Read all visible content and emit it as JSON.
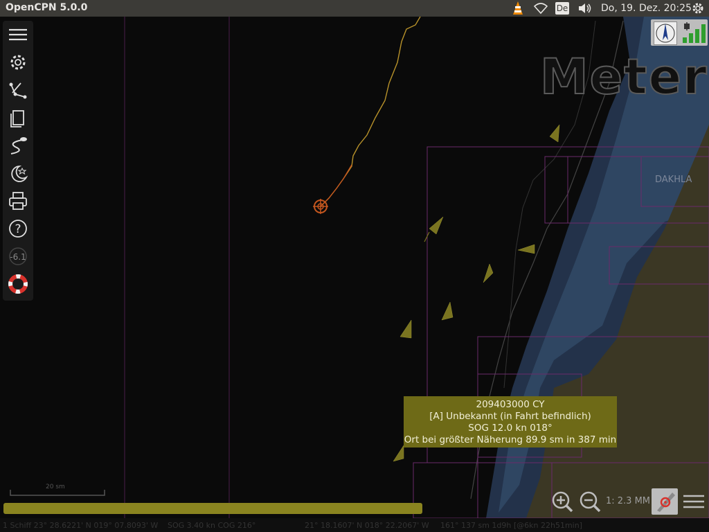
{
  "topbar": {
    "title": "OpenCPN 5.0.0",
    "keyboard_layout": "De",
    "clock": "Do, 19. Dez. 20:25",
    "tray_icons": [
      "vlc-icon",
      "wifi-icon",
      "keyboard-layout",
      "volume-icon",
      "settings-gear-icon"
    ]
  },
  "toolbar": {
    "items": [
      "menu-icon",
      "gear-icon",
      "route-icon",
      "document-icon",
      "track-icon",
      "moon-star-icon",
      "printer-icon",
      "help-icon",
      "compass-icon",
      "lifebuoy-icon"
    ],
    "compass_value": "-6.1"
  },
  "chart": {
    "watermark": "Meter",
    "place_label": "DAKHLA",
    "colors": {
      "water_deep": "#0a0a0a",
      "water_shallow": "#1f2c3e",
      "water_mid": "#2a3b52",
      "land": "#3d3824",
      "boundary": "#6b2a6b",
      "track": "#b8922a",
      "ais": "#7a7420"
    }
  },
  "tooltip": {
    "line1": "209403000 CY",
    "line2": "[A] Unbekannt (in Fahrt befindlich)",
    "line3": "SOG 12.0 kn 018°",
    "line4": "Ort bei größter Näherung 89.9 sm in 387 min"
  },
  "controls": {
    "scale": "1: 2.3 MM",
    "scale_bar_label": "20 sm"
  },
  "progress": {
    "fraction": 1.0
  },
  "statusbar": {
    "ship": "1 Schiff 23° 28.6221' N   019° 07.8093' W",
    "sog": "SOG 3.40 kn  COG 216°",
    "cursor": "21° 18.1607' N   018° 22.2067' W",
    "bearing": "161°  137 sm 1d9h [@6kn 22h51min]"
  }
}
